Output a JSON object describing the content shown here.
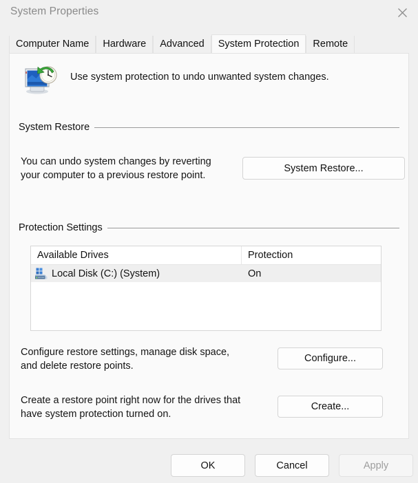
{
  "window": {
    "title": "System Properties",
    "close_icon": "close-icon"
  },
  "tabs": [
    {
      "label": "Computer Name",
      "active": false
    },
    {
      "label": "Hardware",
      "active": false
    },
    {
      "label": "Advanced",
      "active": false
    },
    {
      "label": "System Protection",
      "active": true
    },
    {
      "label": "Remote",
      "active": false
    }
  ],
  "header": {
    "icon": "system-restore-icon",
    "text": "Use system protection to undo unwanted system changes."
  },
  "system_restore_group": {
    "label": "System Restore",
    "description": "You can undo system changes by reverting\nyour computer to a previous restore point.",
    "button_label": "System Restore..."
  },
  "protection_settings_group": {
    "label": "Protection Settings",
    "list": {
      "columns": [
        "Available Drives",
        "Protection"
      ],
      "rows": [
        {
          "icon": "hard-drive-icon",
          "drive": "Local Disk (C:) (System)",
          "protection": "On",
          "selected": true
        }
      ]
    },
    "configure": {
      "description": "Configure restore settings, manage disk space,\nand delete restore points.",
      "button_label": "Configure..."
    },
    "create": {
      "description": "Create a restore point right now for the drives that\nhave system protection turned on.",
      "button_label": "Create..."
    }
  },
  "footer": {
    "ok_label": "OK",
    "cancel_label": "Cancel",
    "apply_label": "Apply",
    "apply_disabled": true
  },
  "colors": {
    "window_bg": "#f0f0f0",
    "panel_bg": "#fafafa",
    "text": "#141414",
    "title_text": "#8a8a8a",
    "rule": "#9a9a9a",
    "selection": "#efefef"
  }
}
